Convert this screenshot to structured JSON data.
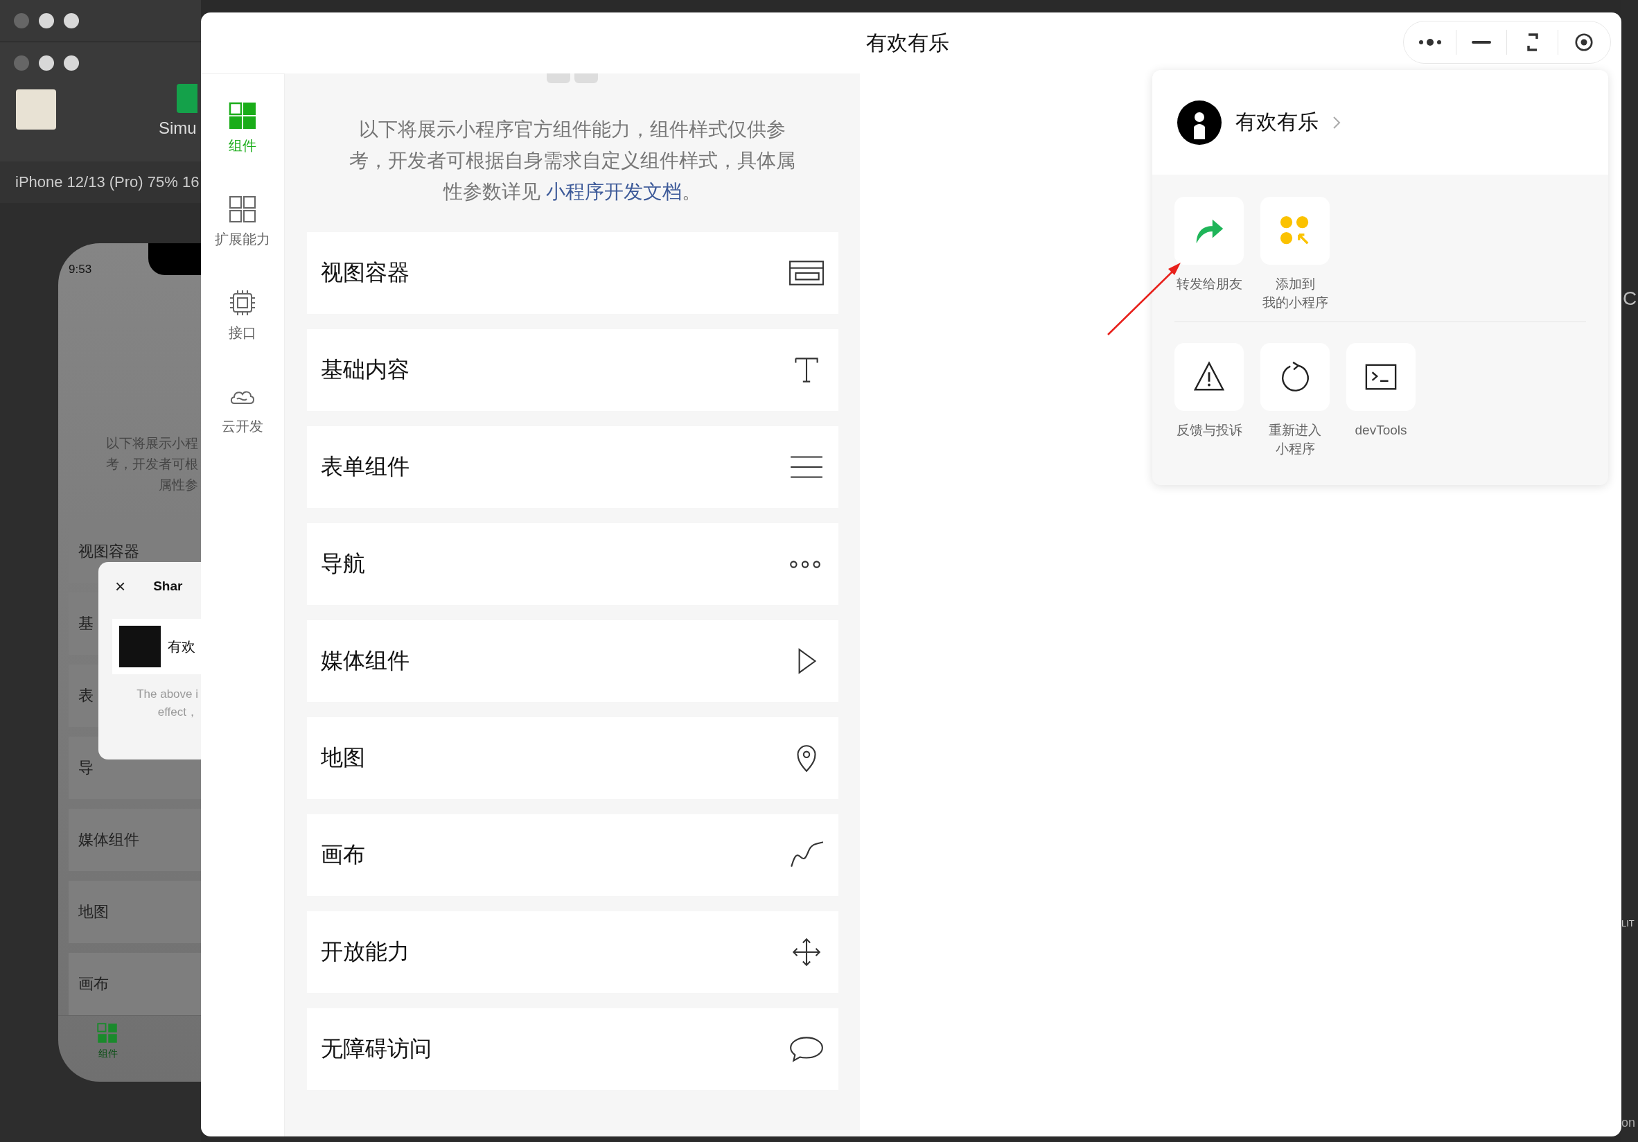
{
  "background_window": {
    "toolbar_label": "Simu",
    "device_label": "iPhone 12/13 (Pro) 75% 16",
    "phone": {
      "time": "9:53",
      "intro_lines": [
        "以下将展示小程",
        "考，开发者可根",
        "属性参"
      ],
      "list_items": [
        "视图容器",
        "基",
        "表",
        "导",
        "媒体组件",
        "地图",
        "画布"
      ],
      "share_dialog": {
        "close_symbol": "×",
        "title": "Shar",
        "app_name": "有欢",
        "note_lines": [
          "The above i",
          "effect，"
        ]
      },
      "tab_label": "组件"
    },
    "edge_texts": [
      "C",
      "LIT",
      "on"
    ]
  },
  "window": {
    "title": "有欢有乐"
  },
  "sidebar": {
    "items": [
      {
        "label": "组件",
        "kind": "components",
        "selected": true
      },
      {
        "label": "扩展能力",
        "kind": "extensions",
        "selected": false
      },
      {
        "label": "接口",
        "kind": "api",
        "selected": false
      },
      {
        "label": "云开发",
        "kind": "cloud",
        "selected": false
      }
    ]
  },
  "intro": {
    "text": "以下将展示小程序官方组件能力，组件样式仅供参考，开发者可根据自身需求自定义组件样式，具体属性参数详见 ",
    "link": "小程序开发文档",
    "end": "。"
  },
  "components": [
    {
      "label": "视图容器",
      "kind": "container"
    },
    {
      "label": "基础内容",
      "kind": "text"
    },
    {
      "label": "表单组件",
      "kind": "form"
    },
    {
      "label": "导航",
      "kind": "nav"
    },
    {
      "label": "媒体组件",
      "kind": "media"
    },
    {
      "label": "地图",
      "kind": "map"
    },
    {
      "label": "画布",
      "kind": "canvas"
    },
    {
      "label": "开放能力",
      "kind": "open"
    },
    {
      "label": "无障碍访问",
      "kind": "a11y"
    }
  ],
  "menu": {
    "app_name": "有欢有乐",
    "rows": [
      [
        {
          "lines": [
            "转发给朋友"
          ],
          "kind": "share"
        },
        {
          "lines": [
            "添加到",
            "我的小程序"
          ],
          "kind": "add"
        }
      ],
      [
        {
          "lines": [
            "反馈与投诉"
          ],
          "kind": "warning"
        },
        {
          "lines": [
            "重新进入",
            "小程序"
          ],
          "kind": "reload"
        },
        {
          "lines": [
            "devTools"
          ],
          "kind": "terminal"
        }
      ]
    ]
  }
}
